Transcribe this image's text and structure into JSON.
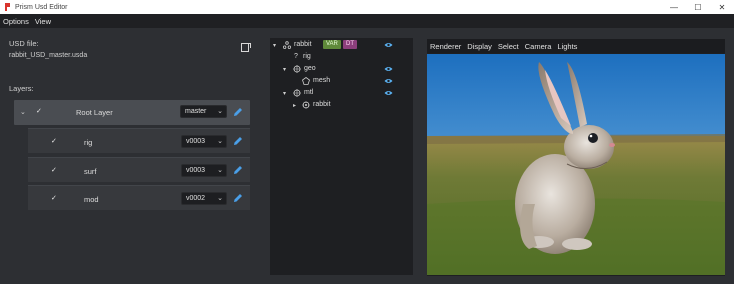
{
  "window": {
    "title": "Prism Usd Editor",
    "controls": {
      "minimize": "—",
      "maximize": "☐",
      "close": "✕"
    }
  },
  "menubar": {
    "items": [
      "Options",
      "View"
    ]
  },
  "left_panel": {
    "usd_label": "USD file:",
    "usd_file": "rabbit_USD_master.usda",
    "layers_label": "Layers:",
    "root_layer": {
      "name": "Root Layer",
      "version": "master",
      "checked": true
    },
    "layers": [
      {
        "name": "rig",
        "version": "v0003",
        "checked": true
      },
      {
        "name": "surf",
        "version": "v0003",
        "checked": true
      },
      {
        "name": "mod",
        "version": "v0002",
        "checked": true
      }
    ]
  },
  "outliner": {
    "nodes": [
      {
        "label": "rabbit",
        "expanded": true,
        "icon": "xform-icon",
        "badges": [
          "VAR",
          "DT"
        ],
        "visible": true
      },
      {
        "label": "rig",
        "expanded": false,
        "icon": "question-icon",
        "badges": [],
        "visible": null
      },
      {
        "label": "geo",
        "expanded": true,
        "icon": "xform-target-icon",
        "badges": [],
        "visible": true
      },
      {
        "label": "mesh",
        "expanded": false,
        "icon": "mesh-icon",
        "badges": [],
        "visible": true
      },
      {
        "label": "mtl",
        "expanded": true,
        "icon": "xform-target-icon",
        "badges": [],
        "visible": true
      },
      {
        "label": "rabbit",
        "expanded": false,
        "icon": "material-icon",
        "badges": [],
        "visible": null
      }
    ]
  },
  "viewport": {
    "menu": [
      "Renderer",
      "Display",
      "Select",
      "Camera",
      "Lights"
    ]
  },
  "colors": {
    "accent_pencil": "#4a9fe8",
    "eye_icon": "#5ab0f0",
    "badge_var": "#5f8a3a",
    "badge_dt": "#8c3f7c"
  }
}
